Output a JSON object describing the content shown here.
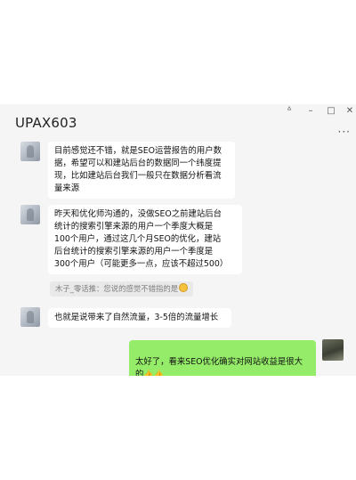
{
  "window": {
    "title": "UPAX603",
    "controls": {
      "pin": "ᐞ",
      "minimize": "–",
      "maximize": "□",
      "close": "✕"
    },
    "more": "···"
  },
  "messages": [
    {
      "side": "in",
      "text": "目前感觉还不错，就是SEO运营报告的用户数\n据，希望可以和建站后台的数据同一个纬度提\n现，比如建站后台我们一般只在数据分析看流\n量来源"
    },
    {
      "side": "in",
      "text": "昨天和优化师沟通的，没做SEO之前建站后台\n统计的搜索引擎来源的用户一个季度大概是\n100个用户，通过这几个月SEO的优化，建站\n后台统计的搜索引擎来源的用户一个季度是\n300个用户（可能更多一点，应该不超过500）"
    },
    {
      "side": "quote",
      "text": "木子_零话推：您说的感觉不错指的是"
    },
    {
      "side": "in",
      "text": "也就是说带来了自然流量，3-5倍的流量增长"
    },
    {
      "side": "out",
      "text": "太好了，看来SEO优化确实对网站收益是很大\n的"
    }
  ],
  "colors": {
    "outgoing_bubble": "#95ec69",
    "incoming_bubble": "#ffffff",
    "chat_bg": "#f5f5f5"
  }
}
